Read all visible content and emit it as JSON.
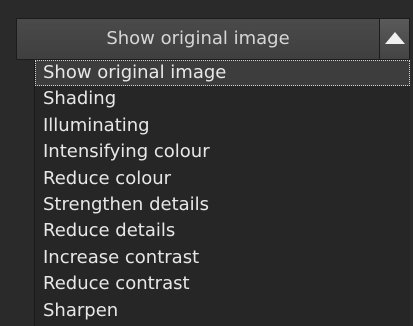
{
  "dropdown": {
    "selected_label": "Show original image",
    "arrow_icon": "triangle-up-icon",
    "options": [
      {
        "label": "Show original image",
        "selected": true
      },
      {
        "label": "Shading",
        "selected": false
      },
      {
        "label": "Illuminating",
        "selected": false
      },
      {
        "label": "Intensifying colour",
        "selected": false
      },
      {
        "label": "Reduce colour",
        "selected": false
      },
      {
        "label": "Strengthen details",
        "selected": false
      },
      {
        "label": "Reduce details",
        "selected": false
      },
      {
        "label": "Increase contrast",
        "selected": false
      },
      {
        "label": "Reduce contrast",
        "selected": false
      },
      {
        "label": "Sharpen",
        "selected": false
      }
    ]
  }
}
